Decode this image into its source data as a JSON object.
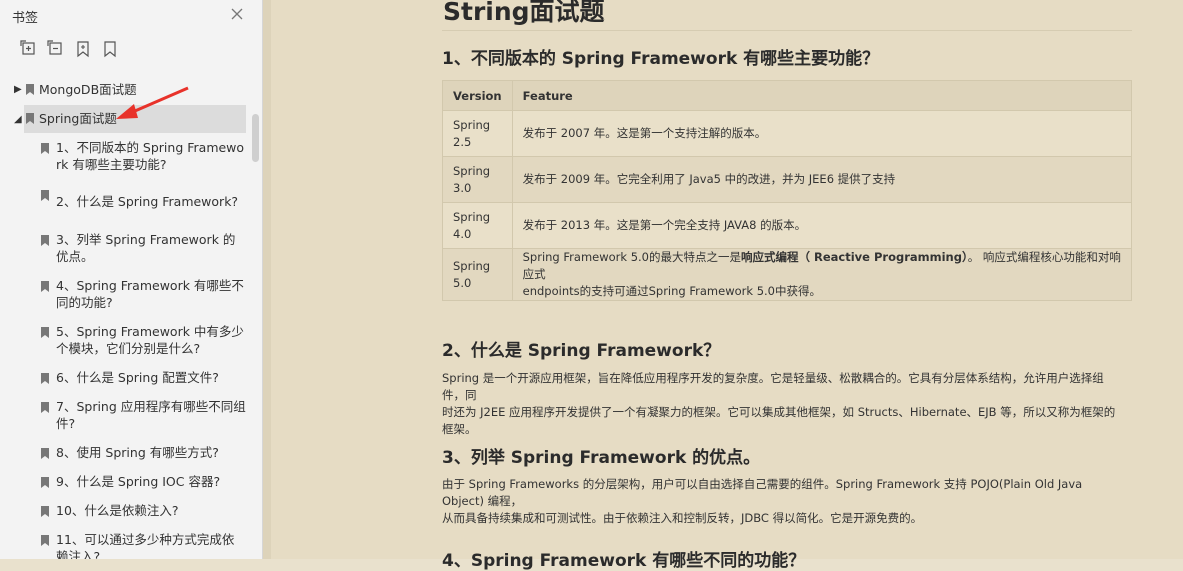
{
  "sidebar": {
    "title": "书签",
    "tools": [
      "expand-all-icon",
      "collapse-all-icon",
      "add-bookmark-icon",
      "bookmark-icon"
    ],
    "items": [
      {
        "label": "MongoDB面试题"
      },
      {
        "label": "Spring面试题"
      },
      {
        "line1": "1、不同版本的 Spring Framewo",
        "line2": "rk 有哪些主要功能?"
      },
      {
        "line1": "2、什么是 Spring Framework?"
      },
      {
        "line1": "3、列举 Spring Framework 的",
        "line2": "优点。"
      },
      {
        "line1": "4、Spring Framework 有哪些不",
        "line2": "同的功能?"
      },
      {
        "line1": "5、Spring Framework 中有多少",
        "line2": "个模块，它们分别是什么?"
      },
      {
        "line1": "6、什么是 Spring 配置文件?"
      },
      {
        "line1": "7、Spring 应用程序有哪些不同组",
        "line2": "件?"
      },
      {
        "line1": "8、使用 Spring 有哪些方式?"
      },
      {
        "line1": "9、什么是 Spring IOC 容器?"
      },
      {
        "line1": "10、什么是依赖注入?"
      },
      {
        "line1": "11、可以通过多少种方式完成依",
        "line2": "赖注入?"
      }
    ]
  },
  "doc": {
    "page_title": "String面试题",
    "s1_title": "1、不同版本的 Spring Framework 有哪些主要功能？",
    "table": {
      "headers": [
        "Version",
        "Feature"
      ],
      "rows": [
        {
          "v1": "Spring",
          "v2": "2.5",
          "feature": "发布于 2007 年。这是第一个支持注解的版本。"
        },
        {
          "v1": "Spring",
          "v2": "3.0",
          "feature": "发布于 2009 年。它完全利用了 Java5 中的改进，并为 JEE6 提供了支持"
        },
        {
          "v1": "Spring",
          "v2": "4.0",
          "feature": "发布于 2013 年。这是第一个完全支持 JAVA8 的版本。"
        },
        {
          "v1": "Spring",
          "v2": "5.0",
          "f_pre": "Spring Framework 5.0的最大特点之一是",
          "f_bold": "响应式编程（ Reactive Programming）",
          "f_post": "。 响应式编程核心功能和对响应式",
          "f_line2": "endpoints的支持可通过Spring Framework 5.0中获得。"
        }
      ]
    },
    "s2_title": "2、什么是 Spring Framework？",
    "s2_l1": "Spring 是一个开源应用框架，旨在降低应用程序开发的复杂度。它是轻量级、松散耦合的。它具有分层体系结构，允许用户选择组件，同",
    "s2_l2": "时还为 J2EE 应用程序开发提供了一个有凝聚力的框架。它可以集成其他框架，如 Structs、Hibernate、EJB 等，所以又称为框架的框架。",
    "s3_title": "3、列举 Spring Framework 的优点。",
    "s3_l1": "由于 Spring Frameworks 的分层架构，用户可以自由选择自己需要的组件。Spring Framework 支持 POJO(Plain Old Java Object) 编程，",
    "s3_l2": "从而具备持续集成和可测试性。由于依赖注入和控制反转，JDBC 得以简化。它是开源免费的。",
    "s4_title": "4、Spring Framework 有哪些不同的功能？"
  }
}
